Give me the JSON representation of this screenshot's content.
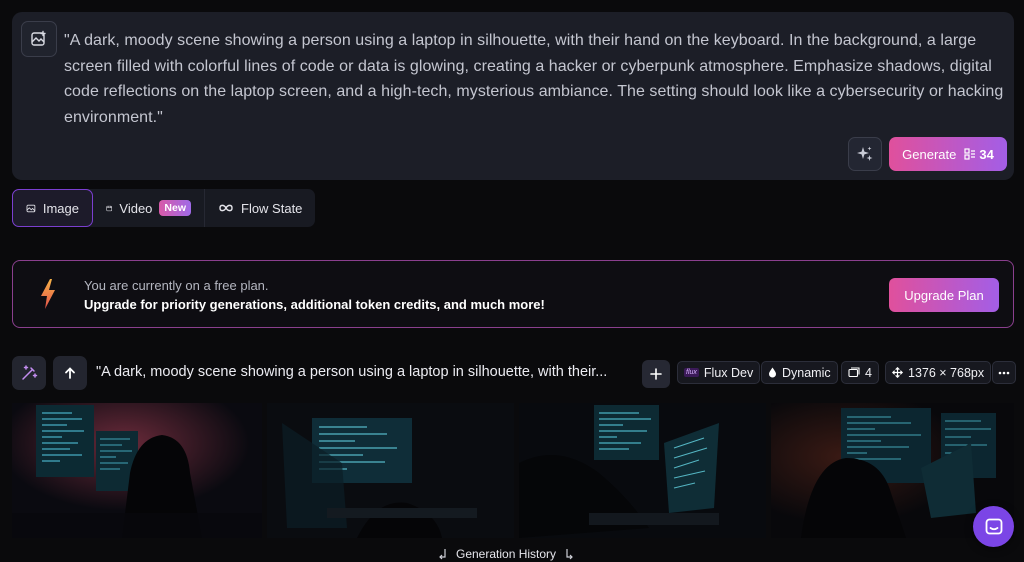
{
  "prompt": {
    "text": "\"A dark, moody scene showing a person using a laptop in silhouette, with their hand on the keyboard. In the background, a large screen filled with colorful lines of code or data is glowing, creating a hacker or cyberpunk atmosphere. Emphasize shadows, digital code reflections on the laptop screen, and a high-tech, mysterious ambiance. The setting should look like a cybersecurity or hacking environment.\"",
    "generate_label": "Generate",
    "token_cost": "34",
    "icons": {
      "image": "image-plus-icon",
      "magic": "sparkle-icon",
      "token": "token-stack-icon"
    }
  },
  "tabs": [
    {
      "label": "Image",
      "icon": "image-icon",
      "active": true
    },
    {
      "label": "Video",
      "icon": "video-icon",
      "badge": "New"
    },
    {
      "label": "Flow State",
      "icon": "infinity-icon"
    }
  ],
  "banner": {
    "line1": "You are currently on a free plan.",
    "line2": "Upgrade for priority generations, additional token credits, and much more!",
    "button": "Upgrade Plan",
    "icon": "lightning-bolt-icon"
  },
  "generation": {
    "prompt_preview": "\"A dark, moody scene showing a person using a laptop in silhouette, with their...",
    "model": "Flux Dev",
    "model_badge": "flux",
    "style": "Dynamic",
    "count": "4",
    "dimensions": "1376 × 768px"
  },
  "history_label": "Generation History",
  "colors": {
    "accent_start": "#e0509c",
    "accent_end": "#a35ee6",
    "active_tab_border": "#7b3fd0",
    "chat_bubble": "#7b45e6"
  }
}
